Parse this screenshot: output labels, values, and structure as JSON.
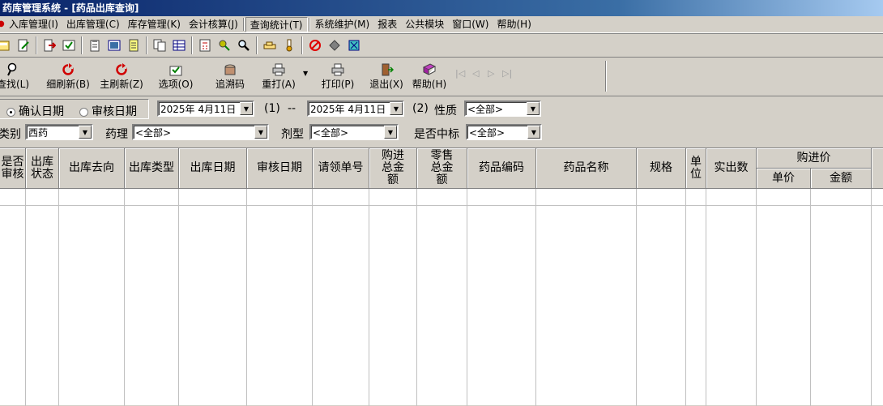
{
  "window": {
    "title": "药库管理系统 - [药品出库查询]"
  },
  "menu": [
    "入库管理(I)",
    "出库管理(C)",
    "库存管理(K)",
    "会计核算(J)",
    "查询统计(T)",
    "系统维护(M)",
    "报表",
    "公共模块",
    "窗口(W)",
    "帮助(H)"
  ],
  "toolbar": {
    "find": "查找(L)",
    "detail_refresh": "细刷新(B)",
    "main_refresh": "主刷新(Z)",
    "options": "选项(O)",
    "trace": "追溯码",
    "reprint": "重打(A)",
    "print": "打印(P)",
    "exit": "退出(X)",
    "help": "帮助(H)"
  },
  "filters": {
    "radio_confirm": "确认日期",
    "radio_audit": "审核日期",
    "date_from": "2025年 4月11日",
    "mark1": "(1)",
    "dash": "--",
    "date_to": "2025年 4月11日",
    "mark2": "(2)",
    "nature_label": "性质",
    "nature_value": "<全部>",
    "category_label": "类别",
    "category_value": "西药",
    "pharm_label": "药理",
    "pharm_value": "<全部>",
    "dosage_label": "剂型",
    "dosage_value": "<全部>",
    "bid_label": "是否中标",
    "bid_value": "<全部>"
  },
  "grid": {
    "columns": [
      "是否审核",
      "出库状态",
      "出库去向",
      "出库类型",
      "出库日期",
      "审核日期",
      "请领单号",
      "购进总金额",
      "零售总金额",
      "药品编码",
      "药品名称",
      "规格",
      "单位",
      "实出数"
    ],
    "group_header": "购进价",
    "sub_columns": [
      "单价",
      "金额"
    ]
  },
  "colors": {
    "title_bg": "#0a246a",
    "face": "#d4d0c8",
    "grid_bg": "#ffffff"
  }
}
